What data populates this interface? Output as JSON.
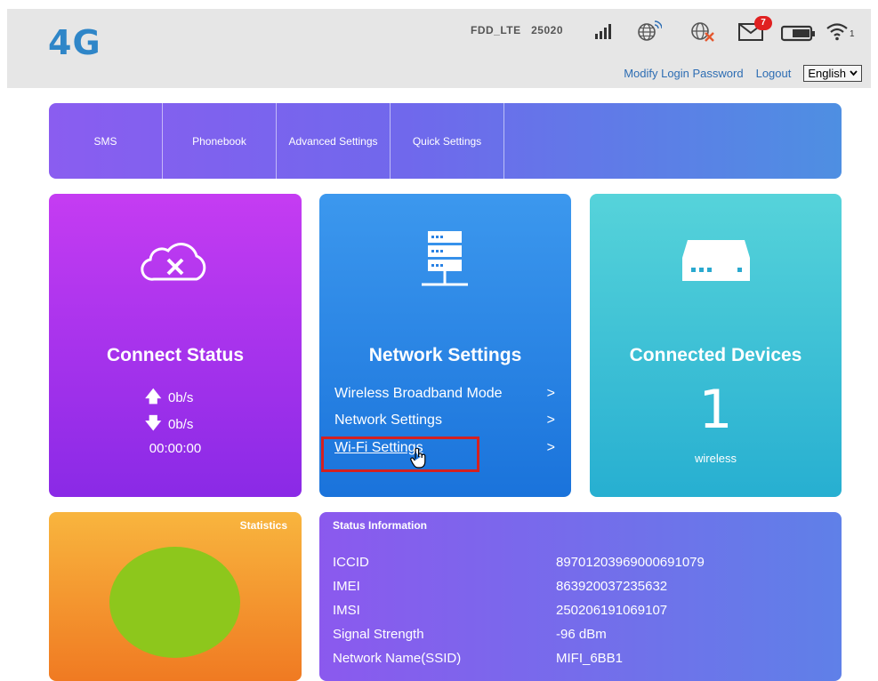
{
  "header": {
    "logo": "4G",
    "network_type": "FDD_LTE",
    "operator_code": "25020",
    "sms_unread_count": "7",
    "wifi_clients": "1",
    "links": {
      "modify_password": "Modify Login Password",
      "logout": "Logout",
      "language": "English"
    }
  },
  "menu": {
    "items": [
      {
        "label": "SMS"
      },
      {
        "label": "Phonebook"
      },
      {
        "label": "Advanced Settings"
      },
      {
        "label": "Quick Settings"
      }
    ]
  },
  "connect_status": {
    "title": "Connect Status",
    "upload": "0b/s",
    "download": "0b/s",
    "duration": "00:00:00"
  },
  "network_settings": {
    "title": "Network Settings",
    "links": [
      {
        "label": "Wireless Broadband Mode"
      },
      {
        "label": "Network Settings"
      },
      {
        "label": "Wi-Fi Settings"
      }
    ]
  },
  "connected_devices": {
    "title": "Connected Devices",
    "count": "1",
    "type": "wireless"
  },
  "statistics": {
    "title": "Statistics"
  },
  "status_info": {
    "title": "Status Information",
    "rows": [
      {
        "label": "ICCID",
        "value": "89701203969000691079"
      },
      {
        "label": "IMEI",
        "value": "863920037235632"
      },
      {
        "label": "IMSI",
        "value": "250206191069107"
      },
      {
        "label": "Signal Strength",
        "value": "-96 dBm"
      },
      {
        "label": "Network Name(SSID)",
        "value": "MIFI_6BB1"
      }
    ]
  },
  "colors": {
    "logo": "#2f86c8",
    "link": "#2d6db3",
    "highlight_box": "#d42020",
    "sms_badge": "#e02020"
  }
}
